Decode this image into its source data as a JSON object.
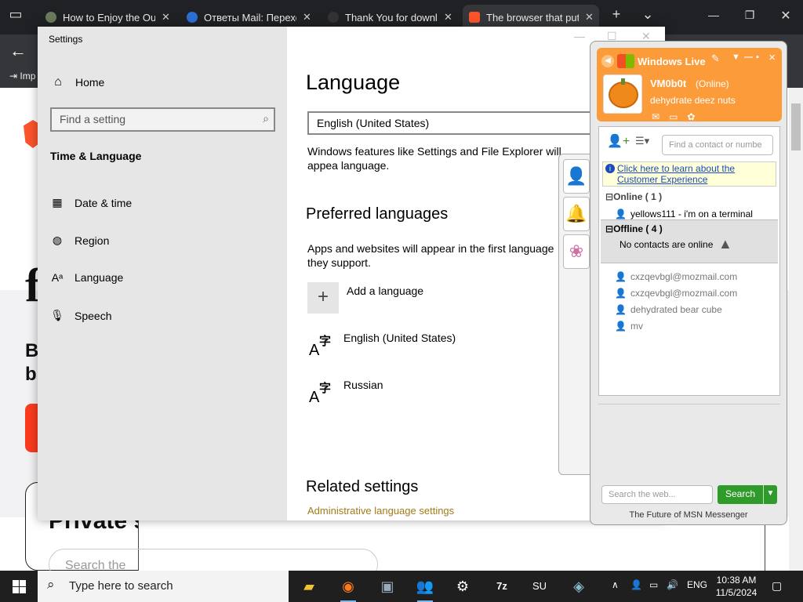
{
  "browser": {
    "tabs": [
      {
        "title": "How to Enjoy the Outd",
        "icon_color": "#6a7a5a"
      },
      {
        "title": "Ответы Mail: Переход",
        "icon_color": "#2b6fd6"
      },
      {
        "title": "Thank You for downloa",
        "icon_color": "#333333"
      },
      {
        "title": "The browser that puts y",
        "icon_color": "#fb542b"
      }
    ],
    "new_tab": "+",
    "tab_list": "⌄",
    "back": "←",
    "bookmark_label": "Imp",
    "window_controls": {
      "minimize": "—",
      "maximize": "❐",
      "close": "✕"
    },
    "page": {
      "fragments": [
        "f",
        "B",
        "b"
      ],
      "heading": "Private s",
      "search_placeholder": "Search the"
    }
  },
  "settings": {
    "window_title": "Settings",
    "controls": {
      "minimize": "—",
      "maximize": "☐",
      "close": "✕"
    },
    "home": "Home",
    "find_placeholder": "Find a setting",
    "section": "Time & Language",
    "nav": [
      {
        "label": "Date & time",
        "icon": "calendar-clock-icon",
        "glyph": "▦"
      },
      {
        "label": "Region",
        "icon": "globe-icon",
        "glyph": "◍"
      },
      {
        "label": "Language",
        "icon": "language-icon",
        "glyph": "Aᵃ"
      },
      {
        "label": "Speech",
        "icon": "microphone-icon",
        "glyph": "🎙"
      }
    ],
    "main": {
      "title": "Language",
      "display_language": "English (United States)",
      "display_desc": "Windows features like Settings and File Explorer will appea language.",
      "preferred_title": "Preferred languages",
      "preferred_desc": "Apps and websites will appear in the first language they support.",
      "add_language": "Add a language",
      "languages": [
        "English (United States)",
        "Russian"
      ],
      "related_title": "Related settings",
      "admin_link": "Administrative language settings"
    }
  },
  "messenger": {
    "brand": "Windows Live",
    "user_name": "VM0b0t",
    "status": "(Online)",
    "personal_message": "dehydrate deez nuts",
    "find_placeholder": "Find a contact or numbe",
    "banner": "Click here to learn about the Customer Experience",
    "online_group": "Online ( 1 )",
    "online_contacts": [
      {
        "name": "yellows111 - i'm on a terminal"
      }
    ],
    "offline_group": "Offline ( 4 )",
    "offline_note": "No contacts are online",
    "offline_contacts": [
      "cxzqevbgl@mozmail.com",
      "cxzqevbgl@mozmail.com",
      "dehydrated bear cube",
      "mv"
    ],
    "web_search_placeholder": "Search the web...",
    "search_button": "Search",
    "footer": "The Future of MSN Messenger"
  },
  "taskbar": {
    "search_placeholder": "Type here to search",
    "apps": [
      "file-explorer",
      "firefox",
      "control-panel",
      "messenger",
      "settings",
      "7zip",
      "su",
      "network"
    ],
    "language": "ENG",
    "time": "10:38 AM",
    "date": "11/5/2024"
  }
}
